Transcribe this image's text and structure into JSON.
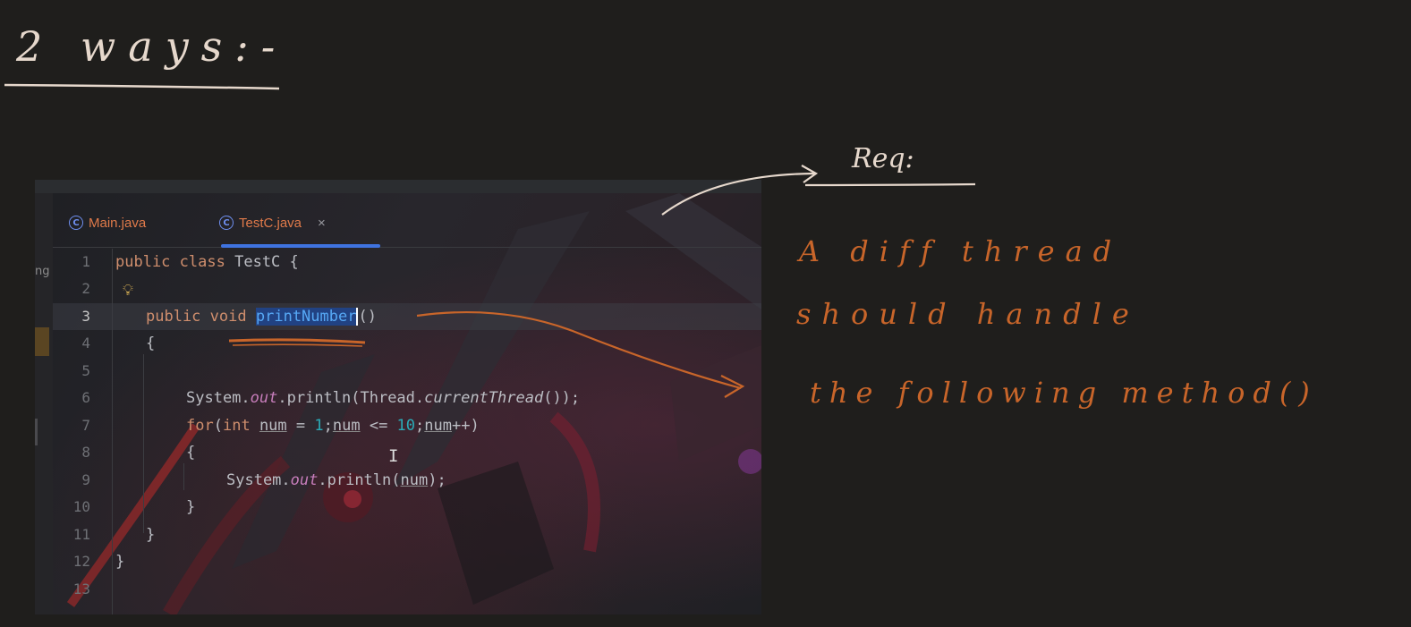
{
  "annotations": {
    "title": "2 ways:-",
    "req_label": "Req:",
    "lines": [
      "A diff thread",
      "should handle",
      "the following method()"
    ],
    "ink_color": "#c8652a",
    "title_color": "#e6d8cc"
  },
  "editor": {
    "sidebar_fragment": "ng",
    "tabs": [
      {
        "label": "Main.java",
        "icon": "class-c-icon",
        "active": false
      },
      {
        "label": "TestC.java",
        "icon": "class-c-icon",
        "active": true,
        "close": "×"
      }
    ],
    "line_numbers": [
      "1",
      "2",
      "3",
      "4",
      "5",
      "6",
      "7",
      "8",
      "9",
      "10",
      "11",
      "12",
      "13"
    ],
    "code": {
      "l1": {
        "kw1": "public",
        "kw2": "class",
        "name": "TestC",
        "brace": "{"
      },
      "l3": {
        "kw1": "public",
        "kw2": "void",
        "method": "printNumber",
        "parens": "()"
      },
      "l4": "{",
      "l6": {
        "pre": "System.",
        "field": "out",
        "mid": ".println(Thread.",
        "call": "currentThread",
        "post": "());"
      },
      "l7": {
        "kw": "for",
        "open": "(",
        "kw2": "int",
        "v1": "num",
        "eq": " = ",
        "n1": "1",
        "semi1": ";",
        "v2": "num",
        "le": " <= ",
        "n2": "10",
        "semi2": ";",
        "v3": "num",
        "post": "++)"
      },
      "l8": "{",
      "l9": {
        "pre": "System.",
        "field": "out",
        "mid": ".println(",
        "v": "num",
        "post": ");"
      },
      "l10": "}",
      "l11": "}",
      "l12": "}"
    }
  }
}
